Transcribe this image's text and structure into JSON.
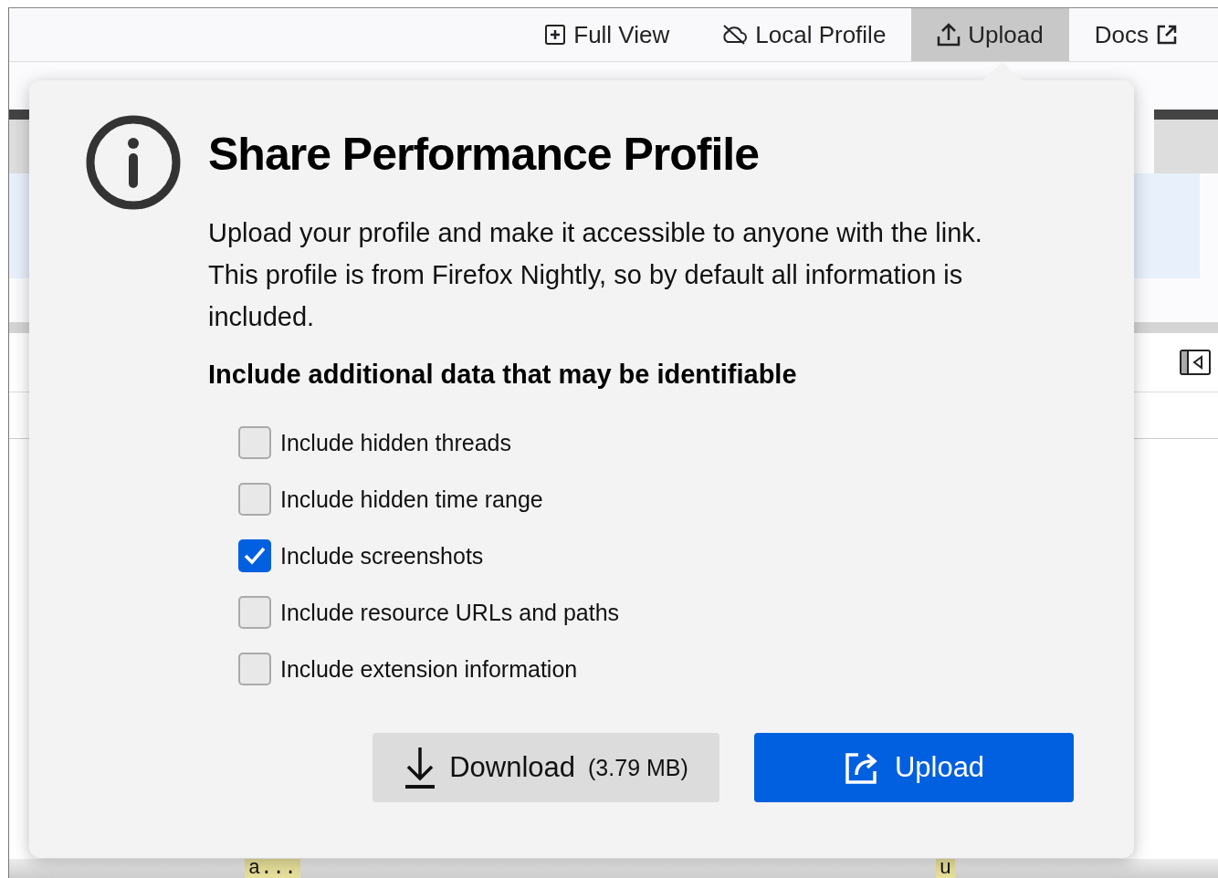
{
  "toolbar": {
    "buttons": [
      {
        "kind": "fullview",
        "label": "Full View",
        "selected": false
      },
      {
        "kind": "local",
        "label": "Local Profile",
        "selected": false
      },
      {
        "kind": "upload",
        "label": "Upload",
        "selected": true
      },
      {
        "kind": "docs",
        "label": "Docs",
        "selected": false
      }
    ]
  },
  "call_tree": {
    "bottom_row": [
      {
        "label": "a..."
      },
      {
        "label": "u"
      }
    ]
  },
  "dialog": {
    "title": "Share Performance Profile",
    "description": "Upload your profile and make it accessible to anyone with the link. This profile is from Firefox Nightly, so by default all information is included.",
    "section_heading": "Include additional data that may be identifiable",
    "options": [
      {
        "label": "Include hidden threads",
        "checked": false
      },
      {
        "label": "Include hidden time range",
        "checked": false
      },
      {
        "label": "Include screenshots",
        "checked": true
      },
      {
        "label": "Include resource URLs and paths",
        "checked": false
      },
      {
        "label": "Include extension information",
        "checked": false
      }
    ],
    "download": {
      "label": "Download",
      "size": "(3.79 MB)"
    },
    "upload": {
      "label": "Upload"
    }
  }
}
